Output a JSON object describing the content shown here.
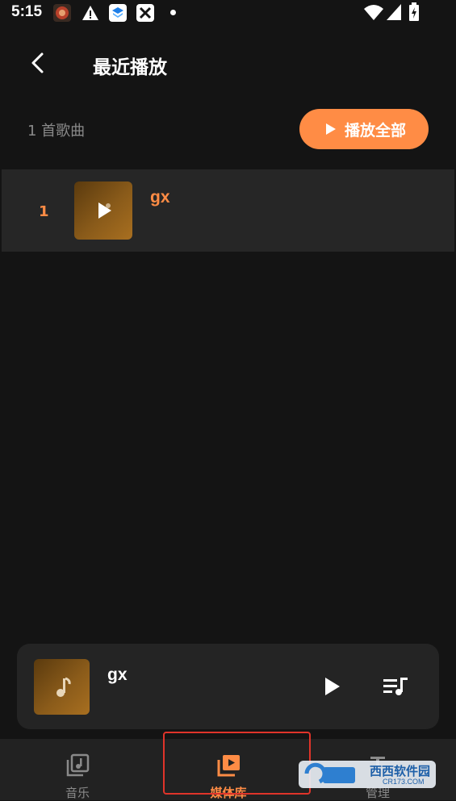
{
  "status_bar": {
    "time": "5:15"
  },
  "header": {
    "title": "最近播放"
  },
  "summary": {
    "count_label": "1 首歌曲",
    "play_all_label": "播放全部"
  },
  "songs": [
    {
      "index": "1",
      "title": "gx"
    }
  ],
  "mini_player": {
    "title": "gx"
  },
  "nav": {
    "items": [
      {
        "label": "音乐"
      },
      {
        "label": "媒体库"
      },
      {
        "label": "管理"
      }
    ]
  },
  "watermark": {
    "text": "西西软件园",
    "sub": "CR173.COM"
  },
  "colors": {
    "accent": "#ff8c45",
    "background": "#141414",
    "row": "#262626",
    "highlight_box": "#e0342a"
  }
}
